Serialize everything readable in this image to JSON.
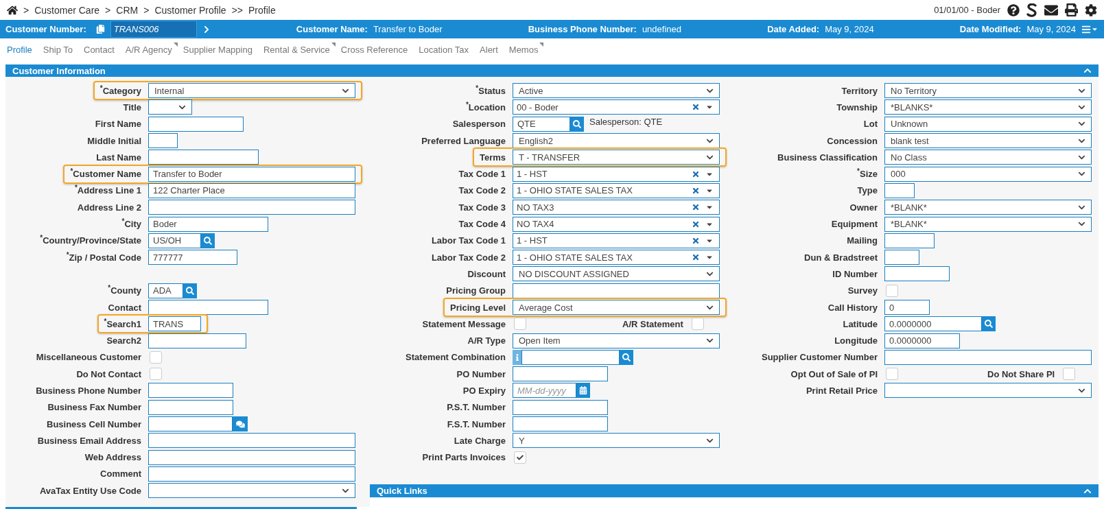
{
  "breadcrumb": [
    {
      "separator": ">",
      "label": "Customer Care"
    },
    {
      "separator": ">",
      "label": "CRM"
    },
    {
      "separator": ">",
      "label": "Customer Profile"
    },
    {
      "separator": ">>",
      "label": "Profile"
    }
  ],
  "session": "01/01/00 - Boder",
  "header_bar": {
    "number_label": "Customer Number:",
    "number_value": "TRANS006",
    "items": [
      {
        "label": "Customer Name:",
        "value": "Transfer to Boder"
      },
      {
        "label": "Business Phone Number:",
        "value": "undefined"
      },
      {
        "label": "Date Added:",
        "value": "May 9, 2024"
      },
      {
        "label": "Date Modified:",
        "value": "May 9, 2024"
      }
    ]
  },
  "tabs": [
    {
      "label": "Profile",
      "selected": true,
      "has_menu": false
    },
    {
      "label": "Ship To",
      "selected": false,
      "has_menu": false
    },
    {
      "label": "Contact",
      "selected": false,
      "has_menu": false
    },
    {
      "label": "A/R Agency",
      "selected": false,
      "has_menu": true
    },
    {
      "label": "Supplier Mapping",
      "selected": false,
      "has_menu": false
    },
    {
      "label": "Rental & Service",
      "selected": false,
      "has_menu": true
    },
    {
      "label": "Cross Reference",
      "selected": false,
      "has_menu": false
    },
    {
      "label": "Location Tax",
      "selected": false,
      "has_menu": false
    },
    {
      "label": "Alert",
      "selected": false,
      "has_menu": false
    },
    {
      "label": "Memos",
      "selected": false,
      "has_menu": true
    }
  ],
  "customer_info": {
    "title": "Customer Information",
    "columns": [
      {
        "rows": [
          {
            "kind": "select",
            "label": "$^{*}$Category",
            "value": "Internal",
            "highlighted": true
          },
          {
            "kind": "select",
            "label": "Title",
            "highlighted": false
          },
          {
            "kind": "input",
            "label": "First Name",
            "highlighted": false
          },
          {
            "kind": "input",
            "label": "Middle Initial",
            "highlighted": false
          },
          {
            "kind": "input",
            "label": "Last Name",
            "highlighted": false
          },
          {
            "kind": "input",
            "label": "$^{*}$Customer Name",
            "value": "Transfer to Boder",
            "highlighted": true
          },
          {
            "kind": "input",
            "label": "$^{*}$Address Line 1",
            "value": "122 Charter Place",
            "highlighted": false
          },
          {
            "kind": "input",
            "label": "Address Line 2",
            "highlighted": false
          },
          {
            "kind": "input",
            "label": "$^{*}$City",
            "value": "Boder",
            "highlighted": false
          },
          {
            "kind": "lookup",
            "label": "$^{*}$Country/Province/State",
            "value": "US/OH",
            "highlighted": false
          },
          {
            "kind": "input",
            "label": "$^{*}$Zip / Postal Code",
            "value": "777777",
            "highlighted": false
          },
          {
            "kind": "spacer"
          },
          {
            "kind": "lookup",
            "label": "$^{*}$County",
            "value": "ADA",
            "highlighted": false
          },
          {
            "kind": "input",
            "label": "Contact",
            "highlighted": false
          },
          {
            "kind": "input",
            "label": "$^{*}$Search1",
            "value": "TRANS",
            "highlighted": true
          },
          {
            "kind": "input",
            "label": "Search2",
            "highlighted": false
          },
          {
            "kind": "checkbox",
            "label": "Miscellaneous Customer",
            "checked": false,
            "highlighted": false
          },
          {
            "kind": "checkbox",
            "label": "Do Not Contact",
            "checked": false,
            "highlighted": false
          },
          {
            "kind": "input",
            "label": "Business Phone Number",
            "highlighted": false
          },
          {
            "kind": "input",
            "label": "Business Fax Number",
            "highlighted": false
          },
          {
            "kind": "chat",
            "label": "Business Cell Number",
            "highlighted": false
          },
          {
            "kind": "input",
            "label": "Business Email Address",
            "highlighted": false
          },
          {
            "kind": "input",
            "label": "Web Address",
            "highlighted": false
          },
          {
            "kind": "input",
            "label": "Comment",
            "highlighted": false
          },
          {
            "kind": "select",
            "label": "AvaTax Entity Use Code",
            "highlighted": false
          }
        ]
      },
      {
        "rows": [
          {
            "kind": "select",
            "label": "$^{*}$Status",
            "value": "Active",
            "highlighted": false
          },
          {
            "kind": "combo",
            "label": "$^{*}$Location",
            "value": "00 - Boder",
            "highlighted": false
          },
          {
            "kind": "lookup",
            "label": "Salesperson",
            "value": "QTE",
            "note": "Salesperson: QTE",
            "highlighted": false
          },
          {
            "kind": "select",
            "label": "Preferred Language",
            "value": "English2",
            "highlighted": false
          },
          {
            "kind": "select",
            "label": "Terms",
            "value": "T - TRANSFER",
            "highlighted": true
          },
          {
            "kind": "combo",
            "label": "Tax Code 1",
            "value": "1 - HST",
            "highlighted": false
          },
          {
            "kind": "combo",
            "label": "Tax Code 2",
            "value": "1 - OHIO STATE SALES TAX",
            "highlighted": false
          },
          {
            "kind": "combo",
            "label": "Tax Code 3",
            "value": "NO TAX3",
            "highlighted": false
          },
          {
            "kind": "combo",
            "label": "Tax Code 4",
            "value": "NO TAX4",
            "highlighted": false
          },
          {
            "kind": "combo",
            "label": "Labor Tax Code 1",
            "value": "1 - HST",
            "highlighted": false
          },
          {
            "kind": "combo",
            "label": "Labor Tax Code 2",
            "value": "1 - OHIO STATE SALES TAX",
            "highlighted": false
          },
          {
            "kind": "select",
            "label": "Discount",
            "value": "NO DISCOUNT ASSIGNED",
            "highlighted": false
          },
          {
            "kind": "input",
            "label": "Pricing Group",
            "highlighted": false
          },
          {
            "kind": "select",
            "label": "Pricing Level",
            "value": "Average Cost",
            "highlighted": true
          },
          {
            "kind": "pair",
            "label": "Statement Message",
            "checked": false,
            "label2": "A/R Statement",
            "checked2": false,
            "highlighted": false
          },
          {
            "kind": "select",
            "label": "A/R Type",
            "value": "Open Item",
            "highlighted": false
          },
          {
            "kind": "info-lookup",
            "label": "Statement Combination",
            "highlighted": false
          },
          {
            "kind": "input",
            "label": "PO Number",
            "highlighted": false
          },
          {
            "kind": "date",
            "label": "PO Expiry",
            "placeholder": "MM-dd-yyyy",
            "highlighted": false
          },
          {
            "kind": "input",
            "label": "P.S.T. Number",
            "highlighted": false
          },
          {
            "kind": "input",
            "label": "F.S.T. Number",
            "highlighted": false
          },
          {
            "kind": "select",
            "label": "Late Charge",
            "value": "Y",
            "highlighted": false
          },
          {
            "kind": "checkbox",
            "label": "Print Parts Invoices",
            "checked": true,
            "highlighted": false
          }
        ]
      },
      {
        "rows": [
          {
            "kind": "select",
            "label": "Territory",
            "value": "No Territory",
            "highlighted": false
          },
          {
            "kind": "select",
            "label": "Township",
            "value": "*BLANKS*",
            "highlighted": false
          },
          {
            "kind": "select",
            "label": "Lot",
            "value": "Unknown",
            "highlighted": false
          },
          {
            "kind": "select",
            "label": "Concession",
            "value": "blank test",
            "highlighted": false
          },
          {
            "kind": "select",
            "label": "Business Classification",
            "value": "No Class",
            "highlighted": false
          },
          {
            "kind": "select",
            "label": "$^{*}$Size",
            "value": "000",
            "highlighted": false
          },
          {
            "kind": "input",
            "label": "Type",
            "highlighted": false
          },
          {
            "kind": "select",
            "label": "Owner",
            "value": "*BLANK*",
            "highlighted": false
          },
          {
            "kind": "select",
            "label": "Equipment",
            "value": "*BLANK*",
            "highlighted": false
          },
          {
            "kind": "input",
            "label": "Mailing",
            "highlighted": false
          },
          {
            "kind": "input",
            "label": "Dun & Bradstreet",
            "highlighted": false
          },
          {
            "kind": "input",
            "label": "ID Number",
            "highlighted": false
          },
          {
            "kind": "checkbox",
            "label": "Survey",
            "checked": false,
            "highlighted": false
          },
          {
            "kind": "input",
            "label": "Call History",
            "value": "0",
            "highlighted": false
          },
          {
            "kind": "lookup",
            "label": "Latitude",
            "value": "0.0000000",
            "highlighted": false
          },
          {
            "kind": "input",
            "label": "Longitude",
            "value": "0.0000000",
            "highlighted": false
          },
          {
            "kind": "input",
            "label": "Supplier Customer Number",
            "highlighted": false
          },
          {
            "kind": "pair",
            "label": "Opt Out of Sale of PI",
            "checked": false,
            "label2": "Do Not Share PI",
            "checked2": false,
            "highlighted": false
          },
          {
            "kind": "select",
            "label": "Print Retail Price",
            "highlighted": false
          }
        ]
      }
    ]
  },
  "quick_links": {
    "title": "Quick Links"
  }
}
